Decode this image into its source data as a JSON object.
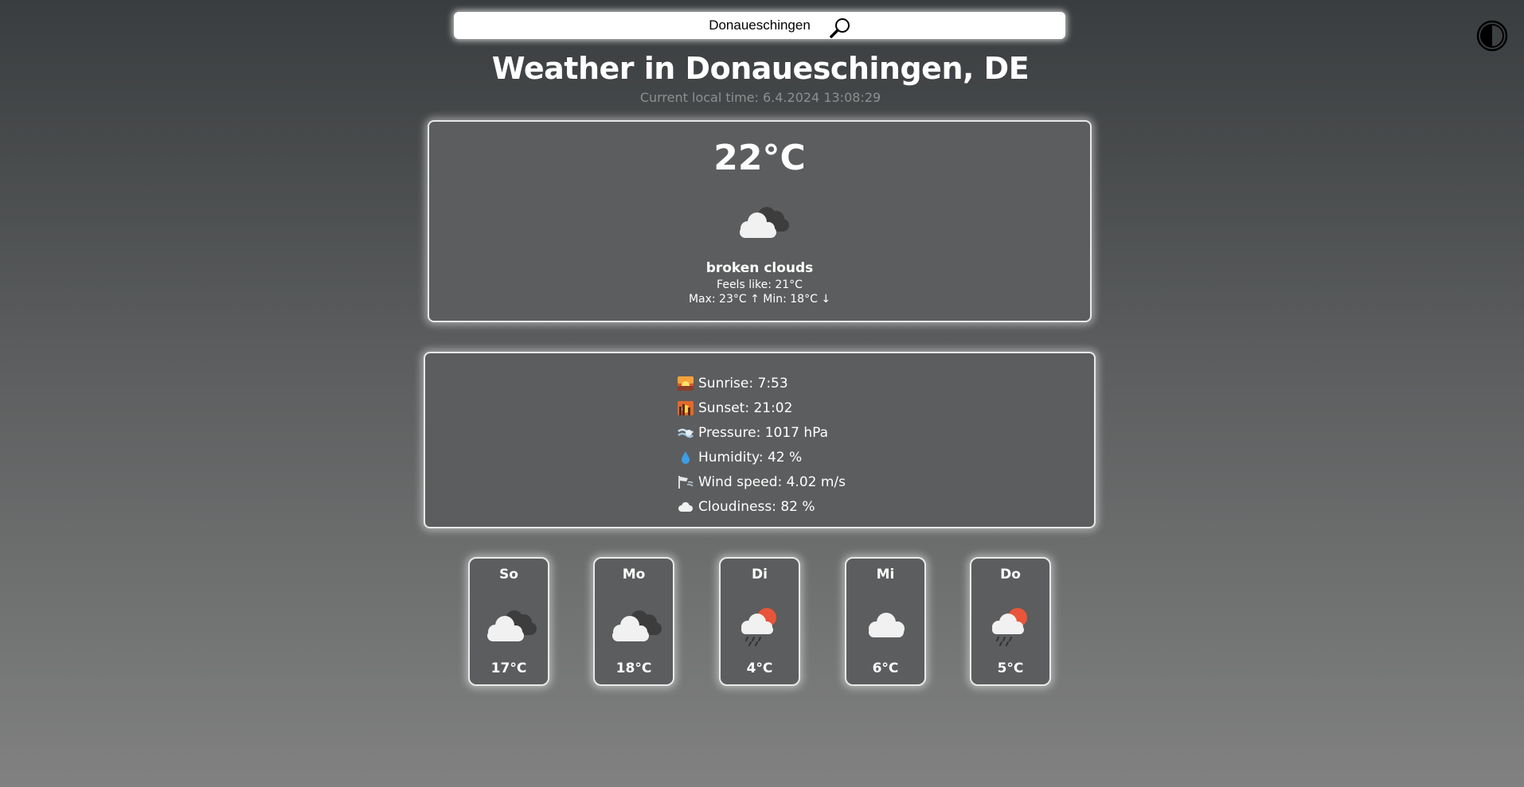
{
  "search": {
    "value": "Donaueschingen"
  },
  "header": {
    "title": "Weather in Donaueschingen, DE",
    "local_time": "Current local time: 6.4.2024 13:08:29"
  },
  "current": {
    "temperature": "22°C",
    "icon": "broken-clouds-icon",
    "description": "broken clouds",
    "feels_like": "Feels like: 21°C",
    "min_max": "Max: 23°C ↑ Min: 18°C ↓"
  },
  "details": [
    {
      "icon": "sunrise-icon",
      "label": "Sunrise: 7:53"
    },
    {
      "icon": "sunset-icon",
      "label": "Sunset: 21:02"
    },
    {
      "icon": "pressure-icon",
      "label": "Pressure: 1017 hPa"
    },
    {
      "icon": "humidity-icon",
      "label": "Humidity: 42 %"
    },
    {
      "icon": "wind-icon",
      "label": "Wind speed: 4.02 m/s"
    },
    {
      "icon": "cloud-icon",
      "label": "Cloudiness: 82 %"
    }
  ],
  "forecast": [
    {
      "day": "So",
      "icon": "broken-clouds-icon",
      "temp": "17°C"
    },
    {
      "day": "Mo",
      "icon": "broken-clouds-icon",
      "temp": "18°C"
    },
    {
      "day": "Di",
      "icon": "rain-sun-icon",
      "temp": "4°C"
    },
    {
      "day": "Mi",
      "icon": "cloud-icon",
      "temp": "6°C"
    },
    {
      "day": "Do",
      "icon": "rain-sun-icon",
      "temp": "5°C"
    }
  ],
  "colors": {
    "card_background": "#5c5d5e",
    "card_border": "#e9e9e9",
    "sun": "#e8553a",
    "cloud_light": "#f1f1f1",
    "cloud_dark": "#3a3a3a"
  }
}
